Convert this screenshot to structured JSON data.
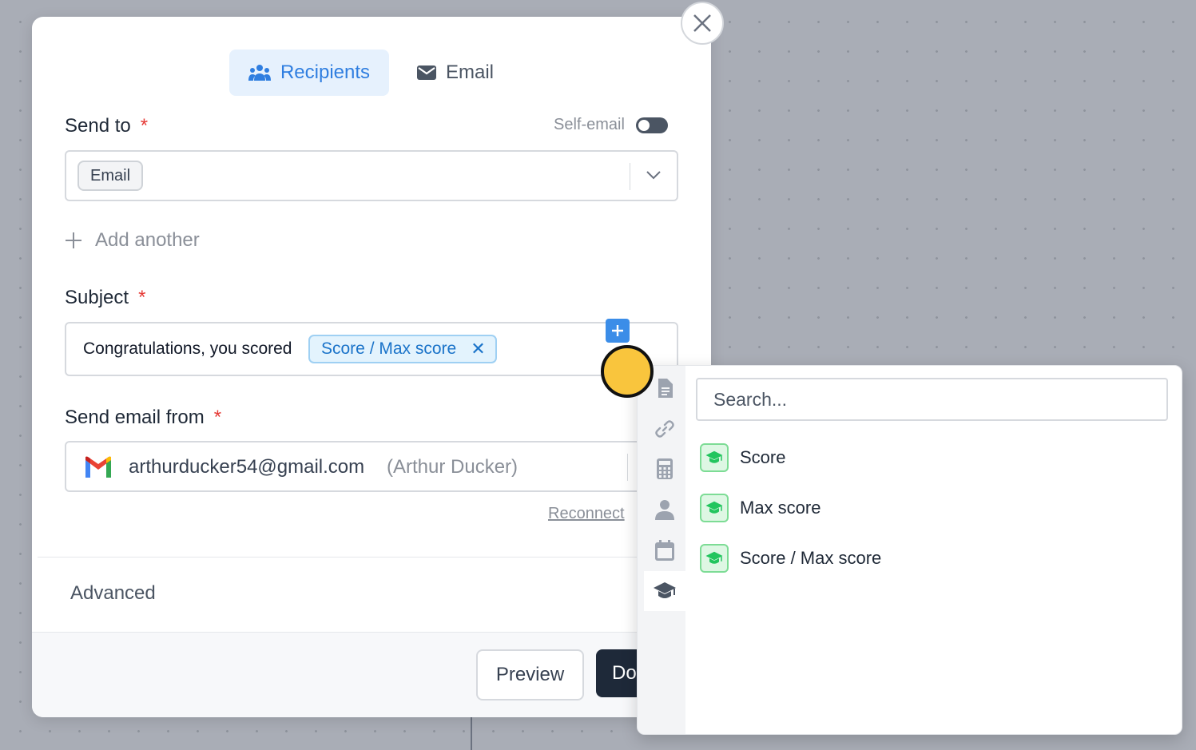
{
  "tabs": {
    "recipients": "Recipients",
    "email": "Email"
  },
  "send_to": {
    "label": "Send to",
    "required_mark": "*",
    "self_email_label": "Self-email",
    "selected_chip": "Email",
    "add_another": "Add another"
  },
  "subject": {
    "label": "Subject",
    "required_mark": "*",
    "text": "Congratulations, you scored",
    "token": "Score / Max score",
    "token_remove": "✕"
  },
  "send_from": {
    "label": "Send email from",
    "required_mark": "*",
    "email": "arthurducker54@gmail.com",
    "name": "(Arthur Ducker)",
    "reconnect": "Reconnect"
  },
  "advanced": "Advanced",
  "footer": {
    "preview": "Preview",
    "done": "Do"
  },
  "variable_picker": {
    "search_placeholder": "Search...",
    "items": [
      "Score",
      "Max score",
      "Score / Max score"
    ]
  },
  "colors": {
    "accent": "#2f7ee0",
    "tab_active_bg": "#e6f1fd",
    "required": "#e53935",
    "token_bg": "#e3f3fd",
    "done_button": "#1e2939",
    "item_icon": "#22c55e",
    "cursor": "#f9c53d"
  }
}
